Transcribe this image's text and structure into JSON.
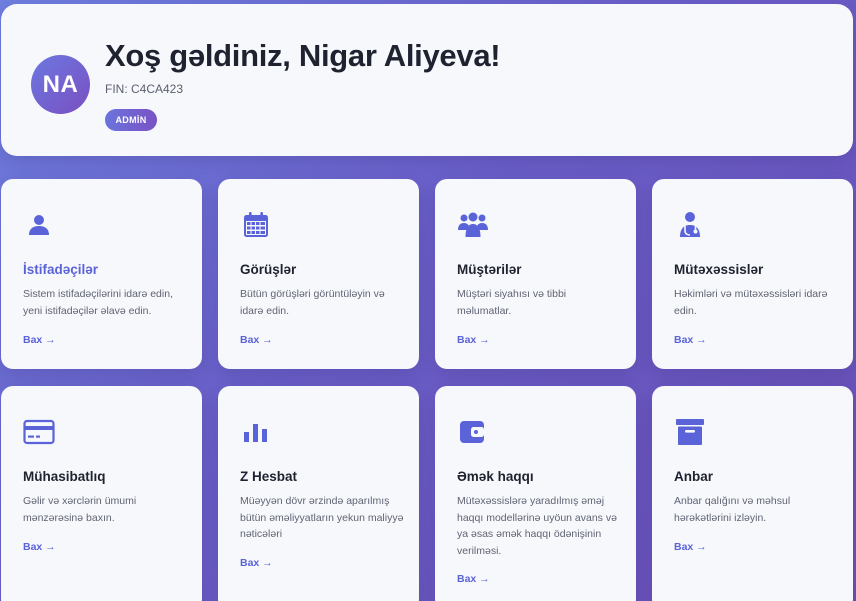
{
  "user": {
    "initials": "NA",
    "welcome": "Xoş gəldiniz, Nigar Aliyeva!",
    "fin": "FIN: C4CA423",
    "role": "ADMİN"
  },
  "colors": {
    "accent": "#5a63d8",
    "card_bg": "#f7f8fc",
    "background_start": "#6f7fe0",
    "background_end": "#6b50b8"
  },
  "cards": [
    {
      "icon": "user-icon",
      "title": "İstifadəçilər",
      "description": "Sistem istifadəçilərini idarə edin, yeni istifadəçilər əlavə edin.",
      "link": "Bax →"
    },
    {
      "icon": "calendar-icon",
      "title": "Görüşlər",
      "description": "Bütün görüşləri görüntüləyin və idarə edin.",
      "link": "Bax →"
    },
    {
      "icon": "users-group-icon",
      "title": "Müştərilər",
      "description": "Müştəri siyahısı və tibbi məlumatlar.",
      "link": "Bax →"
    },
    {
      "icon": "doctor-icon",
      "title": "Mütəxəssislər",
      "description": "Həkimləri və mütəxəssisləri idarə edin.",
      "link": "Bax →"
    },
    {
      "icon": "credit-card-icon",
      "title": "Mühasibatlıq",
      "description": "Gəlir və xərclərin ümumi mənzərəsinə baxın.",
      "link": "Bax →"
    },
    {
      "icon": "bar-chart-icon",
      "title": "Z Hesbat",
      "description": "Müəyyən dövr ərzində aparılmış bütün əməliyyatların yekun maliyyə nəticələri",
      "link": "Bax →"
    },
    {
      "icon": "wallet-icon",
      "title": "Əmək haqqı",
      "description": "Mütəxəssislərə yaradılmış əməj haqqı modellərinə uyöun avans və ya əsas əmək haqqı ödənişinin verilməsi.",
      "link": "Bax →"
    },
    {
      "icon": "archive-box-icon",
      "title": "Anbar",
      "description": "Anbar qalığını və məhsul hərəkətlərini izləyin.",
      "link": "Bax →"
    }
  ]
}
